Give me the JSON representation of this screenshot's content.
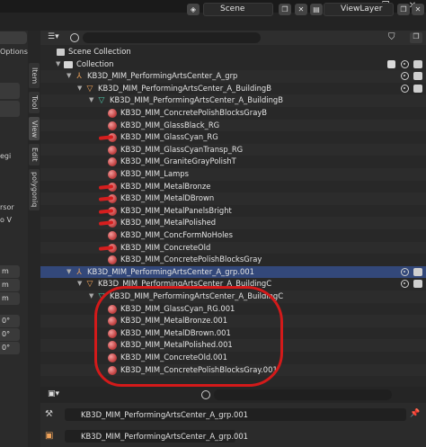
{
  "header": {
    "scene_label": "Scene",
    "viewlayer_label": "ViewLayer"
  },
  "left_panel": {
    "options_label": "Options",
    "tabs": [
      "Item",
      "Tool",
      "View",
      "Edit",
      "polygoniq"
    ],
    "partial_texts": [
      "egi",
      "rsor",
      "o V",
      "m",
      "m",
      "m",
      "0°",
      "0°",
      "0°"
    ]
  },
  "outliner": {
    "header_title": "Scene Collection",
    "rows": [
      {
        "label": "Collection",
        "type": "collection",
        "indent": 0
      },
      {
        "label": "KB3D_MIM_PerformingArtsCenter_A_grp",
        "type": "object",
        "indent": 1
      },
      {
        "label": "KB3D_MIM_PerformingArtsCenter_A_BuildingB",
        "type": "object",
        "indent": 2
      },
      {
        "label": "KB3D_MIM_PerformingArtsCenter_A_BuildingB",
        "type": "mesh",
        "indent": 3
      },
      {
        "label": "KB3D_MIM_ConcretePolishBlocksGrayB",
        "type": "material",
        "indent": 4
      },
      {
        "label": "KB3D_MIM_GlassBlack_RG",
        "type": "material",
        "indent": 4
      },
      {
        "label": "KB3D_MIM_GlassCyan_RG",
        "type": "material",
        "indent": 4
      },
      {
        "label": "KB3D_MIM_GlassCyanTransp_RG",
        "type": "material",
        "indent": 4
      },
      {
        "label": "KB3D_MIM_GraniteGrayPolishT",
        "type": "material",
        "indent": 4
      },
      {
        "label": "KB3D_MIM_Lamps",
        "type": "material",
        "indent": 4
      },
      {
        "label": "KB3D_MIM_MetalBronze",
        "type": "material",
        "indent": 4
      },
      {
        "label": "KB3D_MIM_MetalDBrown",
        "type": "material",
        "indent": 4
      },
      {
        "label": "KB3D_MIM_MetalPanelsBright",
        "type": "material",
        "indent": 4
      },
      {
        "label": "KB3D_MIM_MetalPolished",
        "type": "material",
        "indent": 4
      },
      {
        "label": "KB3D_MIM_ConcFormNoHoles",
        "type": "material",
        "indent": 4
      },
      {
        "label": "KB3D_MIM_ConcreteOld",
        "type": "material",
        "indent": 4
      },
      {
        "label": "KB3D_MIM_ConcretePolishBlocksGray",
        "type": "material",
        "indent": 4
      },
      {
        "label": "KB3D_MIM_PerformingArtsCenter_A_grp.001",
        "type": "object",
        "indent": 1,
        "selected": true
      },
      {
        "label": "KB3D_MIM_PerformingArtsCenter_A_BuildingC",
        "type": "object",
        "indent": 2
      },
      {
        "label": "KB3D_MIM_PerformingArtsCenter_A_BuildingC",
        "type": "mesh",
        "indent": 3
      },
      {
        "label": "KB3D_MIM_GlassCyan_RG.001",
        "type": "material",
        "indent": 4
      },
      {
        "label": "KB3D_MIM_MetalBronze.001",
        "type": "material",
        "indent": 4
      },
      {
        "label": "KB3D_MIM_MetalDBrown.001",
        "type": "material",
        "indent": 4
      },
      {
        "label": "KB3D_MIM_MetalPolished.001",
        "type": "material",
        "indent": 4
      },
      {
        "label": "KB3D_MIM_ConcreteOld.001",
        "type": "material",
        "indent": 4
      },
      {
        "label": "KB3D_MIM_ConcretePolishBlocksGray.001",
        "type": "material",
        "indent": 4
      }
    ]
  },
  "bottom_panel": {
    "object_name": "KB3D_MIM_PerformingArtsCenter_A_grp.001",
    "data_name": "KB3D_MIM_PerformingArtsCenter_A_grp.001"
  },
  "colors": {
    "selection": "#33487a",
    "annotation_red": "#d31a1a",
    "material_red": "#c44545",
    "object_orange": "#f0a35a",
    "mesh_green": "#4ec7a8"
  }
}
